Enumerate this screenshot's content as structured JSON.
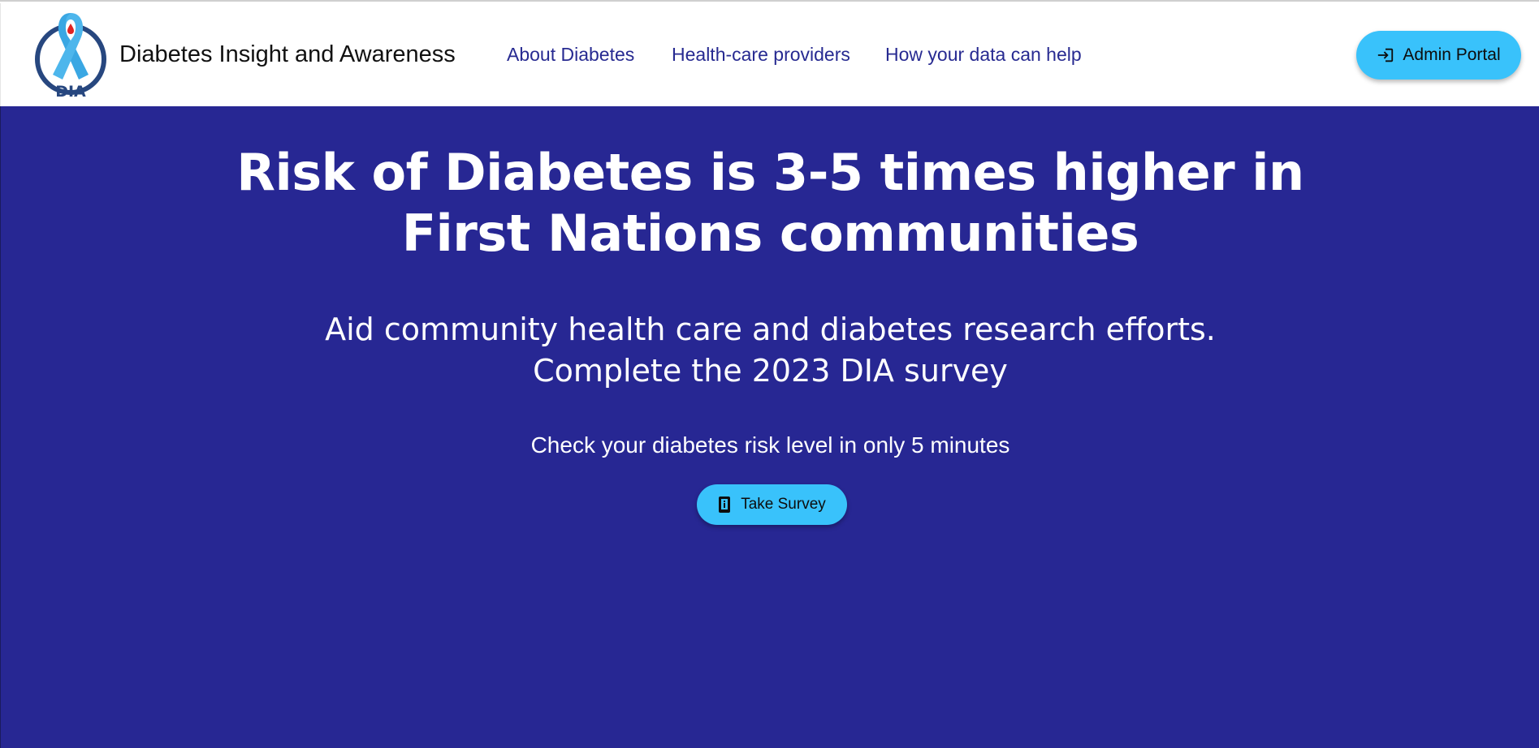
{
  "header": {
    "brand_title": "Diabetes Insight and Awareness",
    "logo_text": "DIA",
    "nav": [
      {
        "label": "About Diabetes"
      },
      {
        "label": "Health-care providers"
      },
      {
        "label": "How your data can help"
      }
    ],
    "admin_button": {
      "label": "Admin Portal",
      "icon": "login-icon"
    }
  },
  "hero": {
    "title_line1": "Risk of Diabetes is 3-5 times higher in",
    "title_line2": "First Nations communities",
    "subtitle_line1": "Aid community health care and diabetes research efforts.",
    "subtitle_line2": "Complete the 2023 DIA survey",
    "check_text": "Check your diabetes risk level in only 5 minutes",
    "survey_button": {
      "label": "Take Survey",
      "icon": "phone-icon"
    }
  },
  "colors": {
    "hero_background": "#272793",
    "nav_link": "#272a91",
    "button": "#39c2fb",
    "logo_ribbon": "#3aa7e3",
    "logo_ring": "#27477f",
    "logo_drop": "#e02323"
  }
}
